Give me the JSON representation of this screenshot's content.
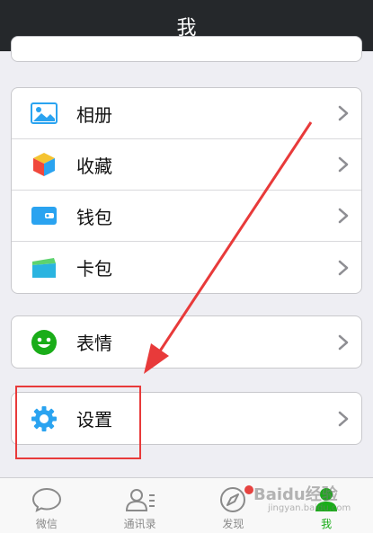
{
  "header": {
    "title": "我"
  },
  "groups": [
    {
      "items": [
        {
          "label": "相册",
          "icon": "photo-album-icon"
        },
        {
          "label": "收藏",
          "icon": "favorites-cube-icon"
        },
        {
          "label": "钱包",
          "icon": "wallet-icon"
        },
        {
          "label": "卡包",
          "icon": "card-pack-icon"
        }
      ]
    },
    {
      "items": [
        {
          "label": "表情",
          "icon": "smiley-icon"
        }
      ]
    },
    {
      "items": [
        {
          "label": "设置",
          "icon": "gear-icon"
        }
      ]
    }
  ],
  "tabbar": {
    "tabs": [
      {
        "label": "微信",
        "icon": "chat-bubble-icon",
        "active": false
      },
      {
        "label": "通讯录",
        "icon": "contacts-icon",
        "active": false
      },
      {
        "label": "发现",
        "icon": "compass-icon",
        "active": false,
        "badge": true
      },
      {
        "label": "我",
        "icon": "person-icon",
        "active": true
      }
    ]
  },
  "annotation": {
    "watermark": "Baidu经验",
    "watermark_sub": "jingyan.baidu.com"
  },
  "colors": {
    "navbar": "#25282b",
    "accent_green": "#1aad19",
    "annotation_red": "#e83a3a",
    "badge_red": "#e64340"
  }
}
